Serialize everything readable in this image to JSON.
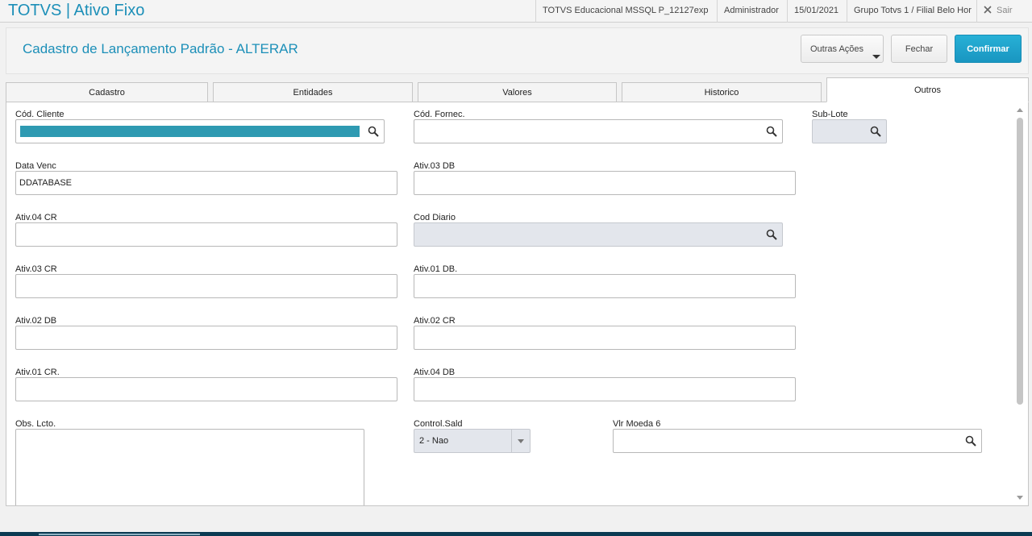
{
  "app": {
    "title": "TOTVS | Ativo Fixo"
  },
  "topbar": {
    "environment": "TOTVS Educacional MSSQL P_12127exp",
    "user": "Administrador",
    "date": "15/01/2021",
    "branch": "Grupo Totvs 1 / Filial Belo Hor",
    "exit_label": "Sair"
  },
  "header": {
    "title": "Cadastro de Lançamento Padrão - ALTERAR",
    "more_actions_label": "Outras Ações",
    "close_label": "Fechar",
    "confirm_label": "Confirmar"
  },
  "tabs": [
    {
      "label": "Cadastro"
    },
    {
      "label": "Entidades"
    },
    {
      "label": "Valores"
    },
    {
      "label": "Historico"
    },
    {
      "label": "Outros",
      "active": true
    }
  ],
  "form": {
    "cod_cliente": {
      "label": "Cód. Cliente",
      "value": ""
    },
    "cod_fornec": {
      "label": "Cód. Fornec.",
      "value": ""
    },
    "sub_lote": {
      "label": "Sub-Lote",
      "value": ""
    },
    "data_venc": {
      "label": "Data Venc",
      "value": "DDATABASE"
    },
    "ativ03_db": {
      "label": "Ativ.03 DB",
      "value": ""
    },
    "ativ04_cr": {
      "label": "Ativ.04 CR",
      "value": ""
    },
    "cod_diario": {
      "label": "Cod Diario",
      "value": ""
    },
    "ativ03_cr": {
      "label": "Ativ.03 CR",
      "value": ""
    },
    "ativ01_db": {
      "label": "Ativ.01 DB.",
      "value": ""
    },
    "ativ02_db": {
      "label": "Ativ.02 DB",
      "value": ""
    },
    "ativ02_cr": {
      "label": "Ativ.02 CR",
      "value": ""
    },
    "ativ01_cr": {
      "label": "Ativ.01 CR.",
      "value": ""
    },
    "ativ04_db": {
      "label": "Ativ.04 DB",
      "value": ""
    },
    "obs_lcto": {
      "label": "Obs. Lcto.",
      "value": ""
    },
    "control_sald": {
      "label": "Control.Sald",
      "value": "2 - Nao"
    },
    "vlr_moeda6": {
      "label": "Vlr Moeda 6",
      "value": ""
    }
  },
  "icons": {
    "search": "magnifier-icon",
    "close": "x-icon",
    "dropdown": "chevron-down-icon"
  },
  "colors": {
    "brand": "#1c8fb8",
    "primary_button": "#1f9fc9",
    "selected_field_fill": "#2e9ab2",
    "readonly_field": "#e3e6ec"
  }
}
